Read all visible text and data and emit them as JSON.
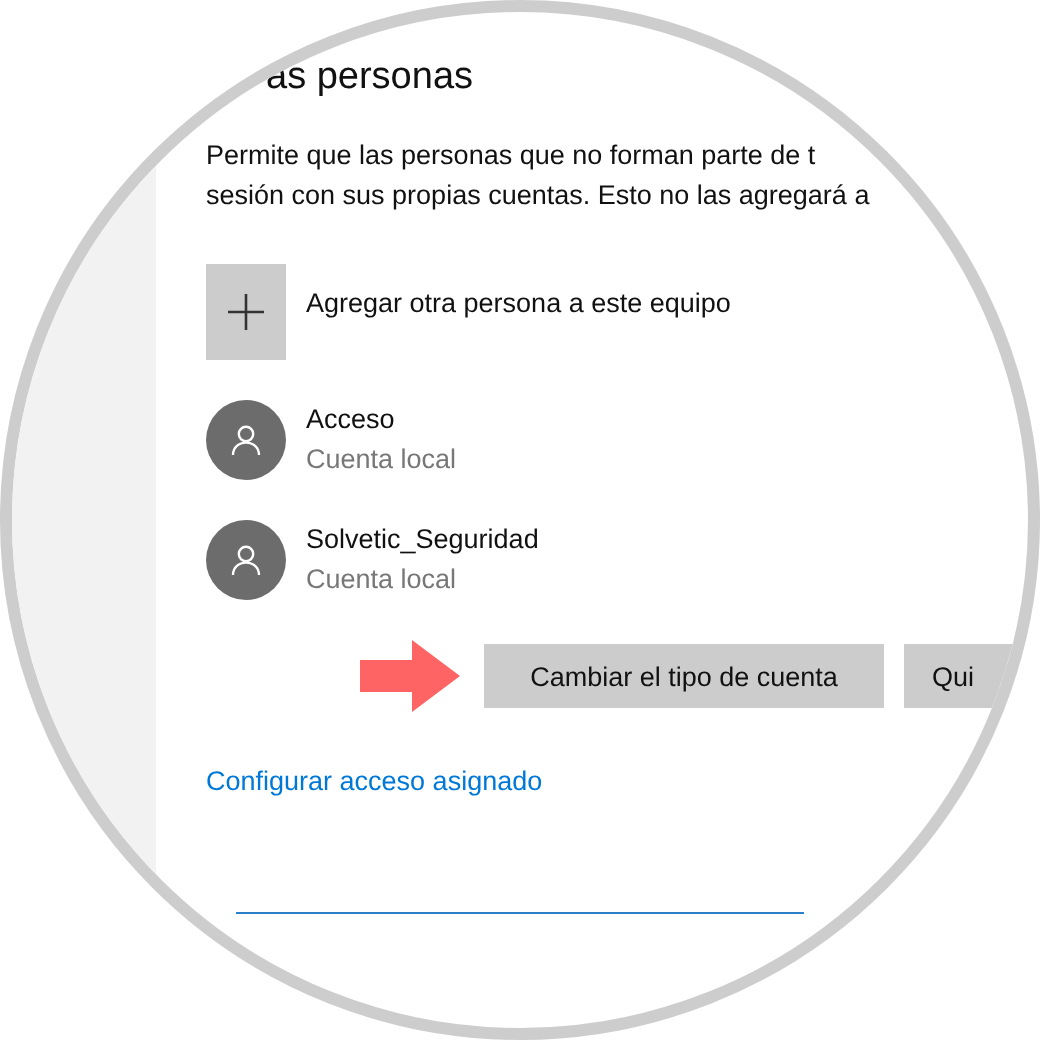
{
  "section": {
    "title": "as personas",
    "description_lines": [
      "Permite que las personas que no forman parte de t",
      "sesión con sus propias cuentas. Esto no las agregará a"
    ]
  },
  "add_person": {
    "label": "Agregar otra persona a este equipo"
  },
  "accounts": [
    {
      "name": "Acceso",
      "type": "Cuenta local"
    },
    {
      "name": "Solvetic_Seguridad",
      "type": "Cuenta local"
    }
  ],
  "buttons": [
    "Cambiar el tipo de cuenta",
    "Qui"
  ],
  "link": "Configurar acceso asignado"
}
